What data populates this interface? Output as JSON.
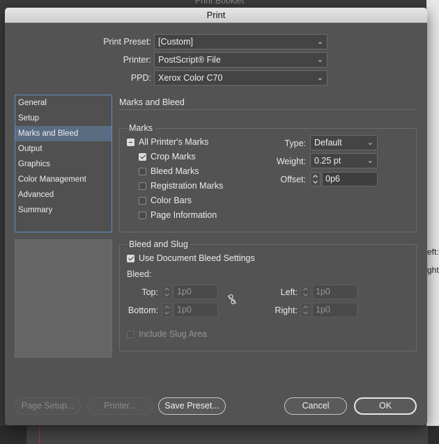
{
  "background": {
    "title": "Print Booklet",
    "right_fragments": [
      "eft:",
      "ght:"
    ]
  },
  "dialog": {
    "title": "Print",
    "print_preset": {
      "label": "Print Preset:",
      "value": "[Custom]"
    },
    "printer": {
      "label": "Printer:",
      "value": "PostScript® File"
    },
    "ppd": {
      "label": "PPD:",
      "value": "Xerox Color C70"
    },
    "categories": [
      {
        "label": "General",
        "selected": false
      },
      {
        "label": "Setup",
        "selected": false
      },
      {
        "label": "Marks and Bleed",
        "selected": true
      },
      {
        "label": "Output",
        "selected": false
      },
      {
        "label": "Graphics",
        "selected": false
      },
      {
        "label": "Color Management",
        "selected": false
      },
      {
        "label": "Advanced",
        "selected": false
      },
      {
        "label": "Summary",
        "selected": false
      }
    ],
    "section_title": "Marks and Bleed",
    "marks": {
      "group_title": "Marks",
      "all_printers_marks": {
        "label": "All Printer's Marks",
        "state": "mixed"
      },
      "crop_marks": {
        "label": "Crop Marks",
        "checked": true
      },
      "bleed_marks": {
        "label": "Bleed Marks",
        "checked": false
      },
      "registration_marks": {
        "label": "Registration Marks",
        "checked": false
      },
      "color_bars": {
        "label": "Color Bars",
        "checked": false
      },
      "page_information": {
        "label": "Page Information",
        "checked": false
      },
      "type": {
        "label": "Type:",
        "value": "Default"
      },
      "weight": {
        "label": "Weight:",
        "value": "0.25 pt"
      },
      "offset": {
        "label": "Offset:",
        "value": "0p6"
      }
    },
    "bleed_slug": {
      "group_title": "Bleed and Slug",
      "use_document_bleed": {
        "label": "Use Document Bleed Settings",
        "checked": true
      },
      "bleed_label": "Bleed:",
      "top": {
        "label": "Top:",
        "value": "1p0"
      },
      "bottom": {
        "label": "Bottom:",
        "value": "1p0"
      },
      "left": {
        "label": "Left:",
        "value": "1p0"
      },
      "right": {
        "label": "Right:",
        "value": "1p0"
      },
      "include_slug": {
        "label": "Include Slug Area",
        "checked": false
      }
    },
    "buttons": {
      "page_setup": "Page Setup...",
      "printer": "Printer...",
      "save_preset": "Save Preset...",
      "cancel": "Cancel",
      "ok": "OK"
    }
  }
}
